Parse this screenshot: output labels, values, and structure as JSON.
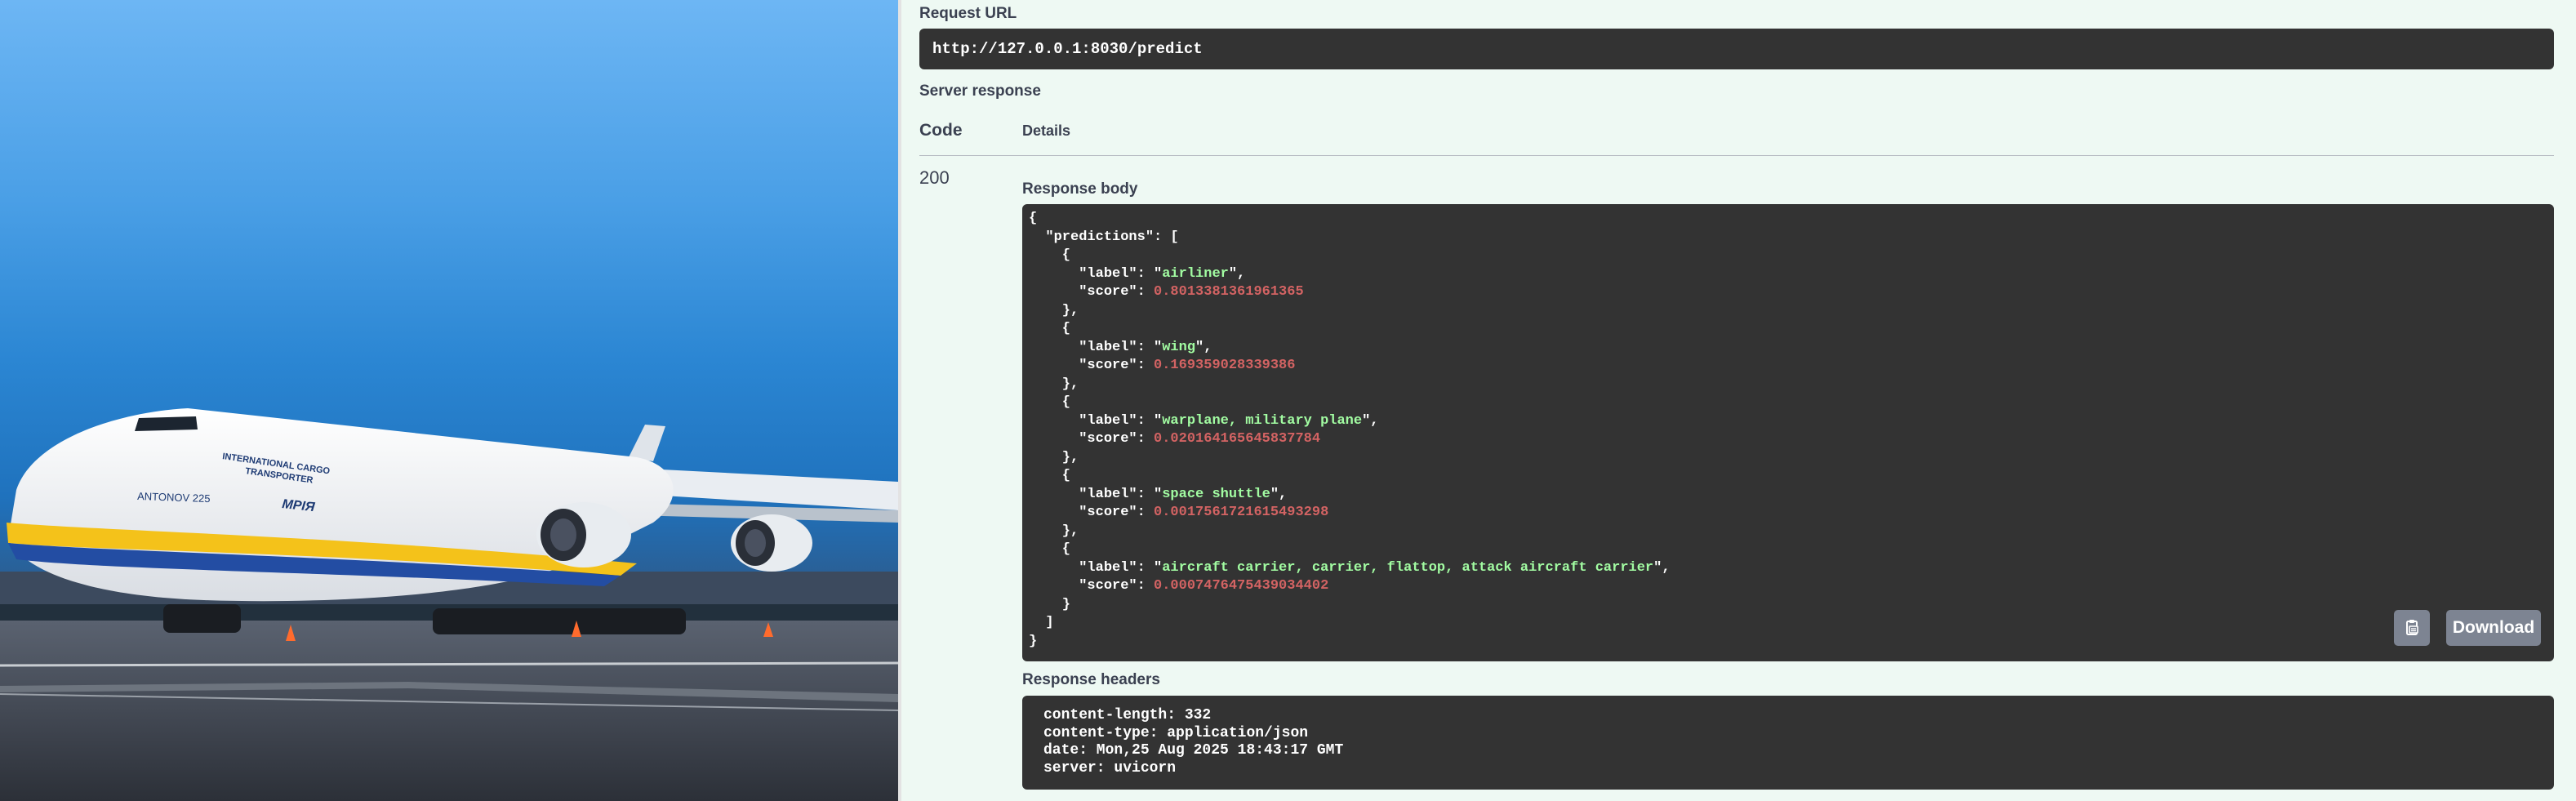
{
  "request_url": {
    "label": "Request URL",
    "value": "http://127.0.0.1:8030/predict"
  },
  "server_response": {
    "label": "Server response",
    "columns": {
      "code": "Code",
      "details": "Details"
    },
    "code": "200",
    "response_body_label": "Response body",
    "body": {
      "open": "{",
      "key_line": "  \"predictions\": [",
      "predictions": [
        {
          "label": "airliner",
          "score": "0.8013381361961365"
        },
        {
          "label": "wing",
          "score": "0.169359028339386"
        },
        {
          "label": "warplane, military plane",
          "score": "0.020164165645837784"
        },
        {
          "label": "space shuttle",
          "score": "0.0017561721615493298"
        },
        {
          "label": "aircraft carrier, carrier, flattop, attack aircraft carrier",
          "score": "0.0007476475439034402"
        }
      ],
      "close_array": "  ]",
      "close": "}"
    },
    "download_label": "Download",
    "copy_icon": "clipboard-copy-icon",
    "response_headers_label": "Response headers",
    "headers": [
      "content-length: 332",
      "content-type: application/json",
      "date: Mon,25 Aug 2025 18:43:17 GMT",
      "server: uvicorn"
    ]
  },
  "photo": {
    "description_icon": "antonov-an225-aircraft-image",
    "aircraft_texts": [
      "INTERNATIONAL CARGO",
      "TRANSPORTER",
      "ANTONOV 225",
      "МРІЯ"
    ]
  },
  "colors": {
    "panel_bg": "#eef9f3",
    "code_bg": "#333333",
    "json_string": "#a2fca2",
    "json_number": "#d36363",
    "button_bg": "#7d8492"
  }
}
